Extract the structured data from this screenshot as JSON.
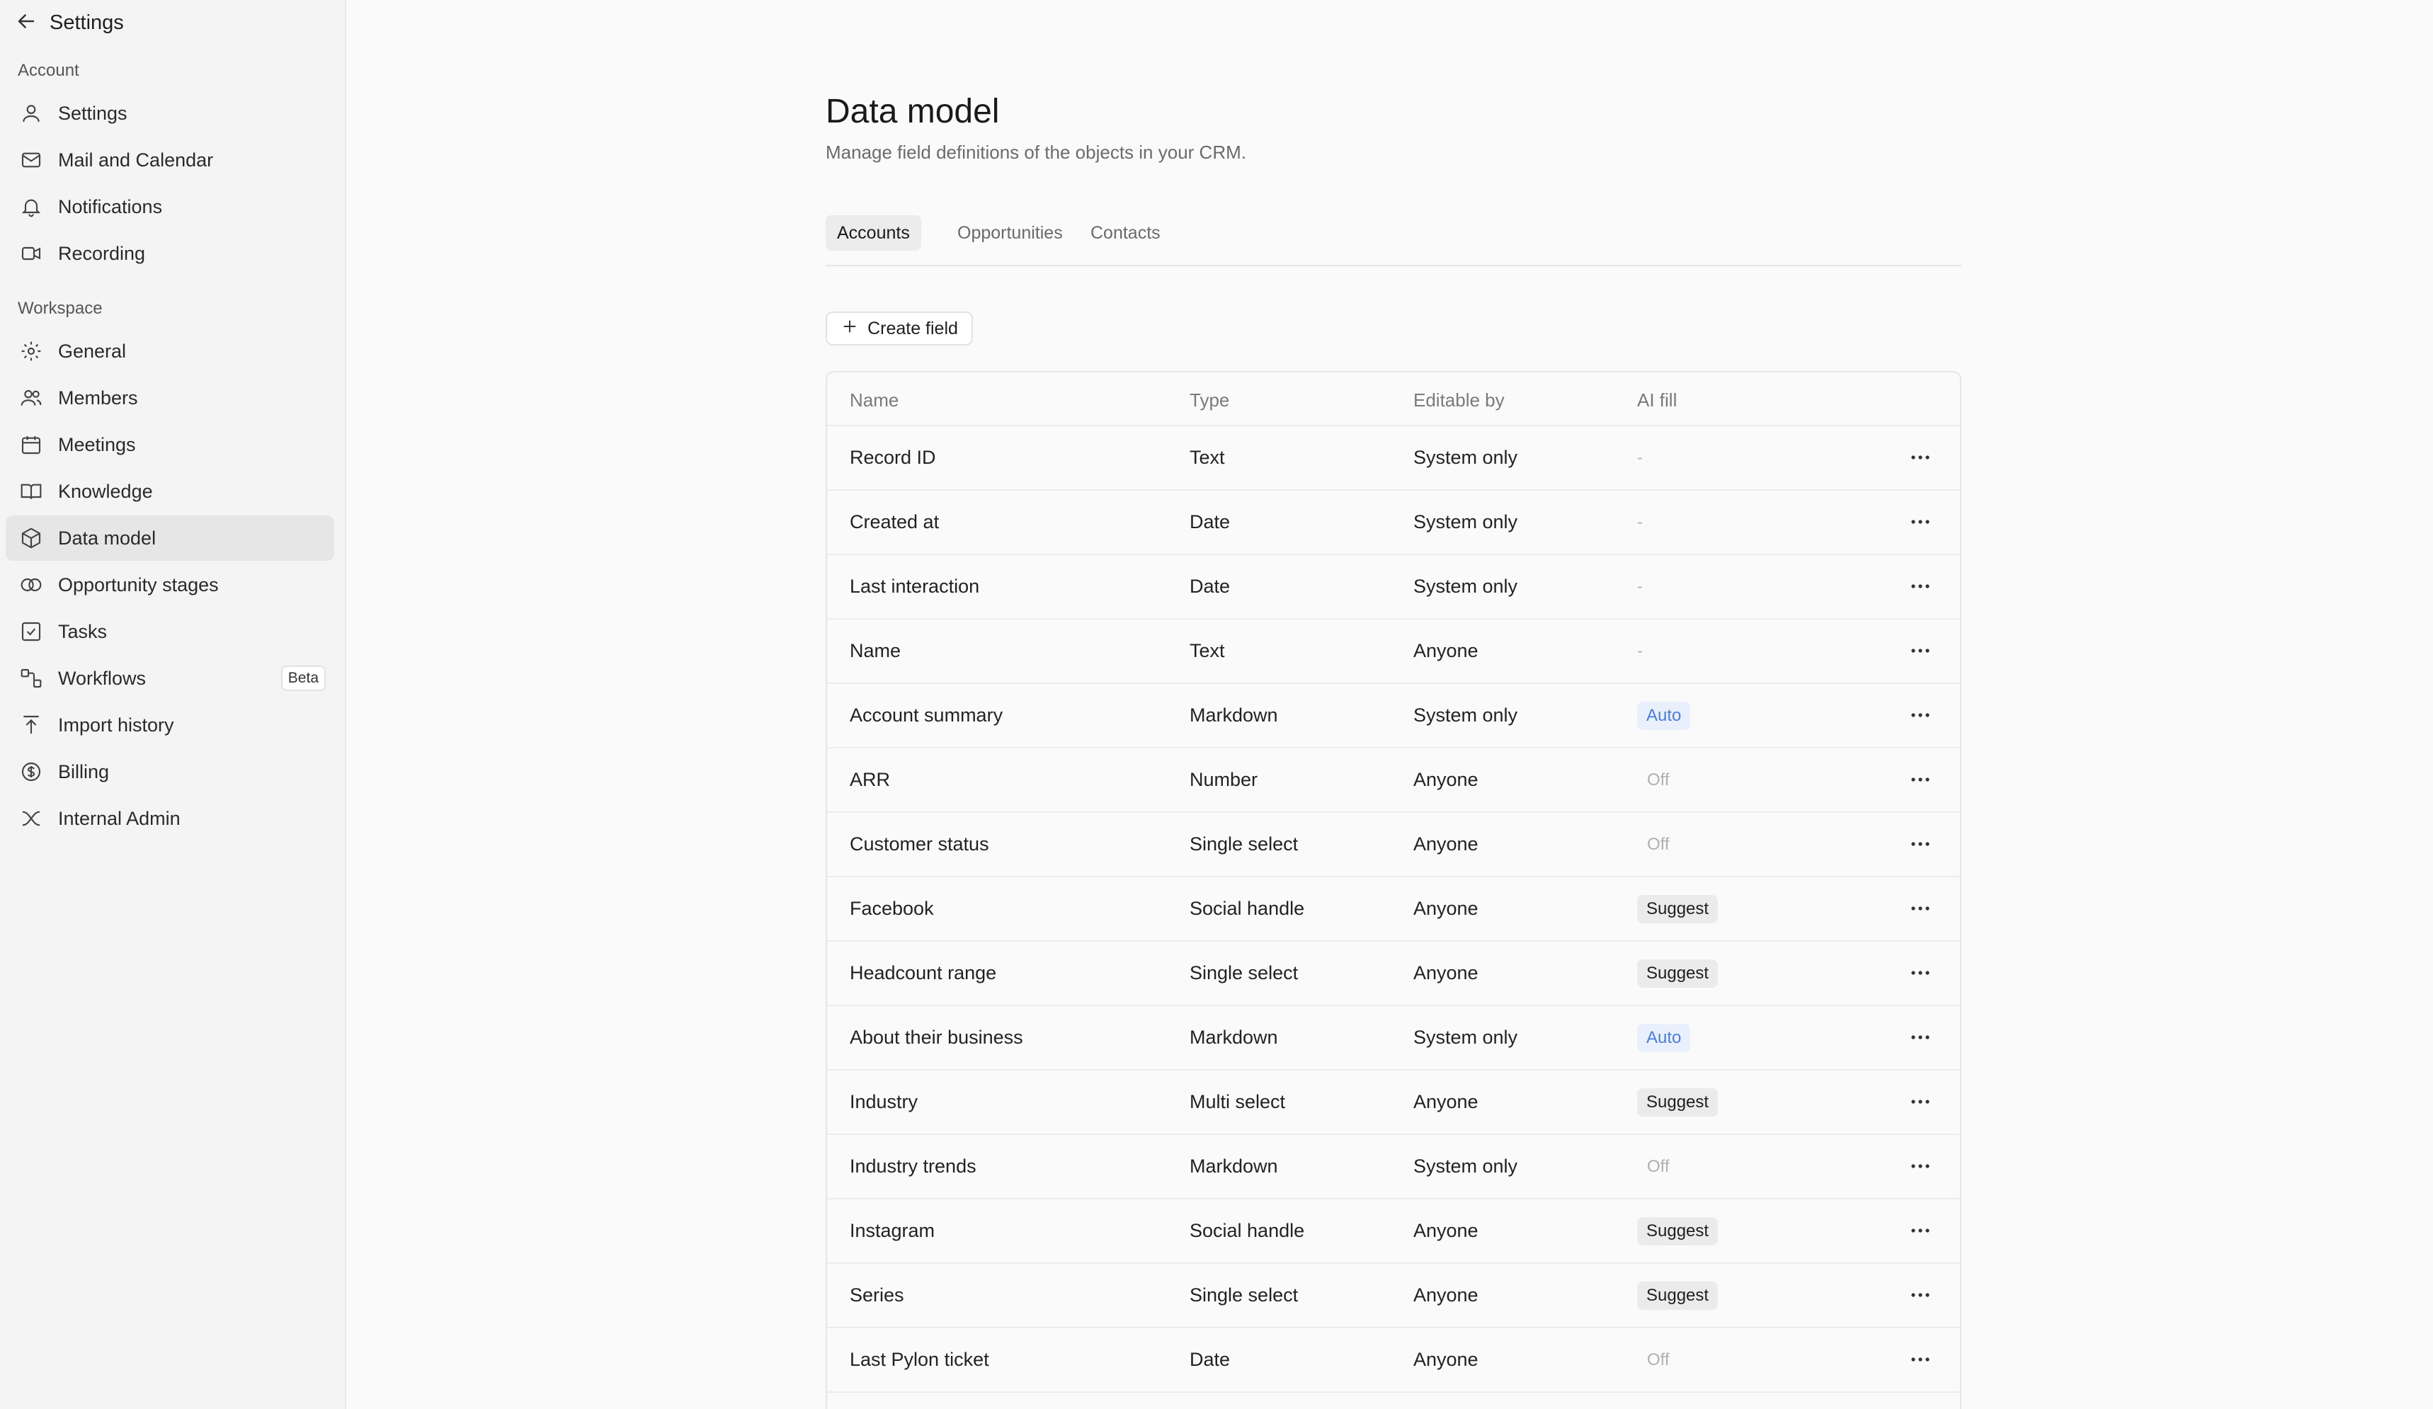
{
  "sidebar": {
    "title": "Settings",
    "account_label": "Account",
    "workspace_label": "Workspace",
    "account_items": [
      {
        "label": "Settings"
      },
      {
        "label": "Mail and Calendar"
      },
      {
        "label": "Notifications"
      },
      {
        "label": "Recording"
      }
    ],
    "workspace_items": [
      {
        "label": "General"
      },
      {
        "label": "Members"
      },
      {
        "label": "Meetings"
      },
      {
        "label": "Knowledge"
      },
      {
        "label": "Data model"
      },
      {
        "label": "Opportunity stages"
      },
      {
        "label": "Tasks"
      },
      {
        "label": "Workflows",
        "badge": "Beta"
      },
      {
        "label": "Import history"
      },
      {
        "label": "Billing"
      },
      {
        "label": "Internal Admin"
      }
    ]
  },
  "main": {
    "title": "Data model",
    "subtitle": "Manage field definitions of the objects in your CRM.",
    "tabs": [
      {
        "label": "Accounts"
      },
      {
        "label": "Opportunities"
      },
      {
        "label": "Contacts"
      }
    ],
    "create_label": "Create field",
    "columns": {
      "name": "Name",
      "type": "Type",
      "editable": "Editable by",
      "ai": "AI fill"
    },
    "rows": [
      {
        "name": "Record ID",
        "type": "Text",
        "editable": "System only",
        "ai": "-"
      },
      {
        "name": "Created at",
        "type": "Date",
        "editable": "System only",
        "ai": "-"
      },
      {
        "name": "Last interaction",
        "type": "Date",
        "editable": "System only",
        "ai": "-"
      },
      {
        "name": "Name",
        "type": "Text",
        "editable": "Anyone",
        "ai": "-"
      },
      {
        "name": "Account summary",
        "type": "Markdown",
        "editable": "System only",
        "ai": "Auto"
      },
      {
        "name": "ARR",
        "type": "Number",
        "editable": "Anyone",
        "ai": "Off"
      },
      {
        "name": "Customer status",
        "type": "Single select",
        "editable": "Anyone",
        "ai": "Off"
      },
      {
        "name": "Facebook",
        "type": "Social handle",
        "editable": "Anyone",
        "ai": "Suggest"
      },
      {
        "name": "Headcount range",
        "type": "Single select",
        "editable": "Anyone",
        "ai": "Suggest"
      },
      {
        "name": "About their business",
        "type": "Markdown",
        "editable": "System only",
        "ai": "Auto"
      },
      {
        "name": "Industry",
        "type": "Multi select",
        "editable": "Anyone",
        "ai": "Suggest"
      },
      {
        "name": "Industry trends",
        "type": "Markdown",
        "editable": "System only",
        "ai": "Off"
      },
      {
        "name": "Instagram",
        "type": "Social handle",
        "editable": "Anyone",
        "ai": "Suggest"
      },
      {
        "name": "Series",
        "type": "Single select",
        "editable": "Anyone",
        "ai": "Suggest"
      },
      {
        "name": "Last Pylon ticket",
        "type": "Date",
        "editable": "Anyone",
        "ai": "Off"
      }
    ]
  },
  "colors": {
    "auto_text": "#4a7ed8",
    "auto_bg": "#e9f0fb",
    "suggest_bg": "#ebebeb",
    "sidebar_bg": "#f4f4f4",
    "active_item_bg": "#e6e6e6"
  }
}
